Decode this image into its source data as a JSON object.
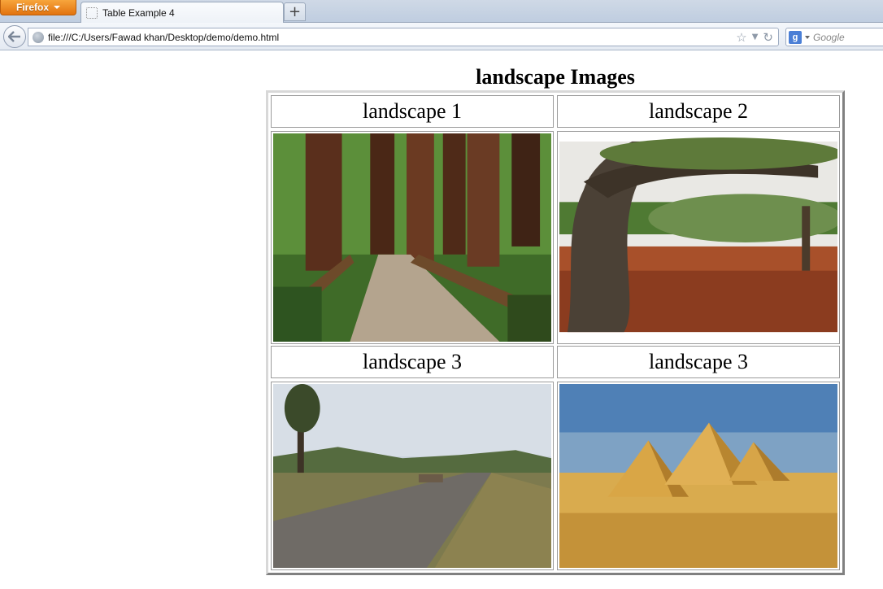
{
  "browser": {
    "app_button_label": "Firefox",
    "tab_title": "Table Example 4",
    "new_tab_label": "+",
    "url": "file:///C:/Users/Fawad khan/Desktop/demo/demo.html",
    "search_engine_letter": "g",
    "search_placeholder": "Google"
  },
  "page": {
    "caption": "landscape Images",
    "headers": [
      "landscape 1",
      "landscape 2",
      "landscape 3",
      "landscape 3"
    ]
  }
}
